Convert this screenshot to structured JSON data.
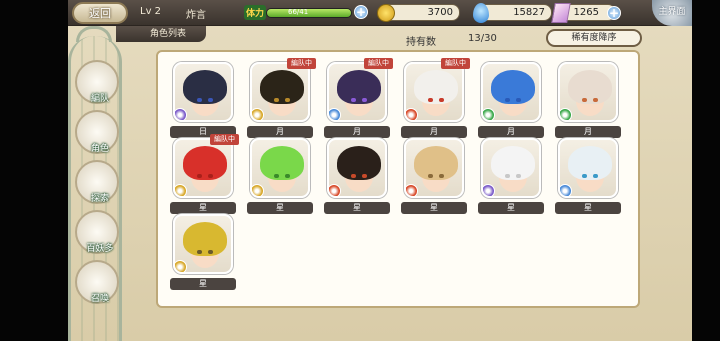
{
  "header": {
    "back_label": "返回",
    "level": "Lv 2",
    "player_name": "炸言",
    "stamina_label": "体力",
    "stamina_text": "66/41",
    "stamina_fill": 1.0,
    "gold": "3700",
    "gems": "15827",
    "crystals": "1265",
    "main_label": "主界面"
  },
  "subheader": {
    "tab_label": "角色列表",
    "owned_label": "持有数",
    "owned_count": "13/30",
    "sort_label": "稀有度降序"
  },
  "sidebar": {
    "items": [
      {
        "label": "編队",
        "icon": "team-icon"
      },
      {
        "label": "角色",
        "icon": "character-icon"
      },
      {
        "label": "探索",
        "icon": "explore-icon"
      },
      {
        "label": "百妖多",
        "icon": "bestiary-icon"
      },
      {
        "label": "召喚",
        "icon": "summon-icon"
      }
    ]
  },
  "characters": [
    {
      "tag": "日",
      "badge": "",
      "hair": "#2a2e44",
      "eye": "#3a56b8",
      "elem": "#7b5bc9"
    },
    {
      "tag": "月",
      "badge": "編队中",
      "hair": "#2b2418",
      "eye": "#b88a2a",
      "elem": "#d8a82a"
    },
    {
      "tag": "月",
      "badge": "編队中",
      "hair": "#3a2d58",
      "eye": "#8a5ad8",
      "elem": "#4a8ad8"
    },
    {
      "tag": "月",
      "badge": "編队中",
      "hair": "#f2f0ec",
      "eye": "#c83a2a",
      "elem": "#d84a2a"
    },
    {
      "tag": "月",
      "badge": "",
      "hair": "#3a7ad8",
      "eye": "#2a5ab8",
      "elem": "#3aa84a"
    },
    {
      "tag": "月",
      "badge": "",
      "hair": "#e8dcd0",
      "eye": "#c86a3a",
      "elem": "#3aa84a"
    },
    {
      "tag": "星",
      "badge": "編队中",
      "hair": "#d8302a",
      "eye": "#a8201a",
      "elem": "#d8a82a"
    },
    {
      "tag": "星",
      "badge": "",
      "hair": "#7ad84a",
      "eye": "#3a8a2a",
      "elem": "#d8a82a"
    },
    {
      "tag": "星",
      "badge": "",
      "hair": "#2a201a",
      "eye": "#c84a2a",
      "elem": "#d84a2a"
    },
    {
      "tag": "星",
      "badge": "",
      "hair": "#e0c088",
      "eye": "#8a6a3a",
      "elem": "#d84a2a"
    },
    {
      "tag": "星",
      "badge": "",
      "hair": "#f4f4f4",
      "eye": "#c8c8c8",
      "elem": "#7b5bc9"
    },
    {
      "tag": "星",
      "badge": "",
      "hair": "#e8f0f4",
      "eye": "#3a9ac8",
      "elem": "#4a8ad8"
    },
    {
      "tag": "星",
      "badge": "",
      "hair": "#d8b830",
      "eye": "#6a5a2a",
      "elem": "#d8a82a"
    }
  ]
}
